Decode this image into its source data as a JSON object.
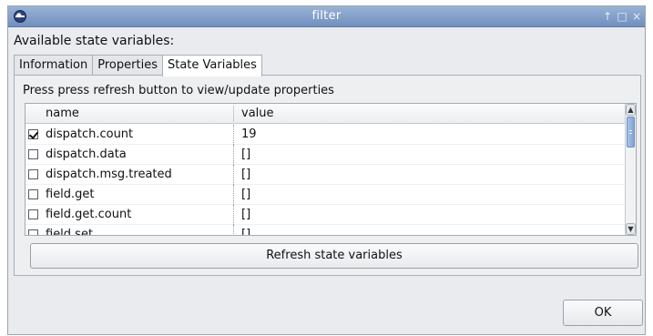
{
  "window": {
    "title": "filter",
    "controls": {
      "up": "↑",
      "maximize": "□",
      "close": "×"
    }
  },
  "available_label": "Available state variables:",
  "tabs": [
    {
      "label": "Information",
      "active": false
    },
    {
      "label": "Properties",
      "active": false
    },
    {
      "label": "State Variables",
      "active": true
    }
  ],
  "panel": {
    "hint": "Press press refresh button to view/update properties",
    "columns": {
      "name": "name",
      "value": "value"
    },
    "rows": [
      {
        "name": "dispatch.count",
        "value": "19",
        "checked": true
      },
      {
        "name": "dispatch.data",
        "value": "[]",
        "checked": false
      },
      {
        "name": "dispatch.msg.treated",
        "value": "[]",
        "checked": false
      },
      {
        "name": "field.get",
        "value": "[]",
        "checked": false
      },
      {
        "name": "field.get.count",
        "value": "[]",
        "checked": false
      },
      {
        "name": "field.set",
        "value": "[]",
        "checked": false
      }
    ],
    "scrollbar": {
      "up_icon": "chevron-up-icon",
      "down_icon": "chevron-down-icon"
    },
    "refresh_label": "Refresh state variables"
  },
  "ok_label": "OK"
}
